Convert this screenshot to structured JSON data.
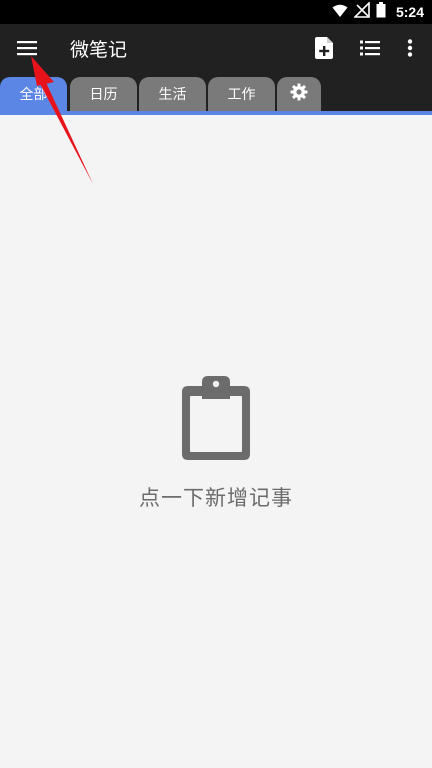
{
  "status_bar": {
    "time": "5:24",
    "icons": [
      "wifi-icon",
      "no-signal-icon",
      "battery-icon"
    ]
  },
  "app_bar": {
    "title": "微笔记",
    "menu_icon": "hamburger-menu-icon",
    "actions": [
      "add-note-icon",
      "list-view-icon",
      "more-vert-icon"
    ]
  },
  "tabs": [
    {
      "label": "全部",
      "active": true
    },
    {
      "label": "日历",
      "active": false
    },
    {
      "label": "生活",
      "active": false
    },
    {
      "label": "工作",
      "active": false
    },
    {
      "label": "",
      "icon": "gear-icon",
      "active": false
    }
  ],
  "empty_state": {
    "icon": "clipboard-icon",
    "message": "点一下新增记事"
  },
  "colors": {
    "app_bar": "#212121",
    "active_tab": "#5b86e5",
    "inactive_tab": "#7a7a7a",
    "background": "#f4f4f4",
    "annotation_arrow": "#e8121b"
  }
}
